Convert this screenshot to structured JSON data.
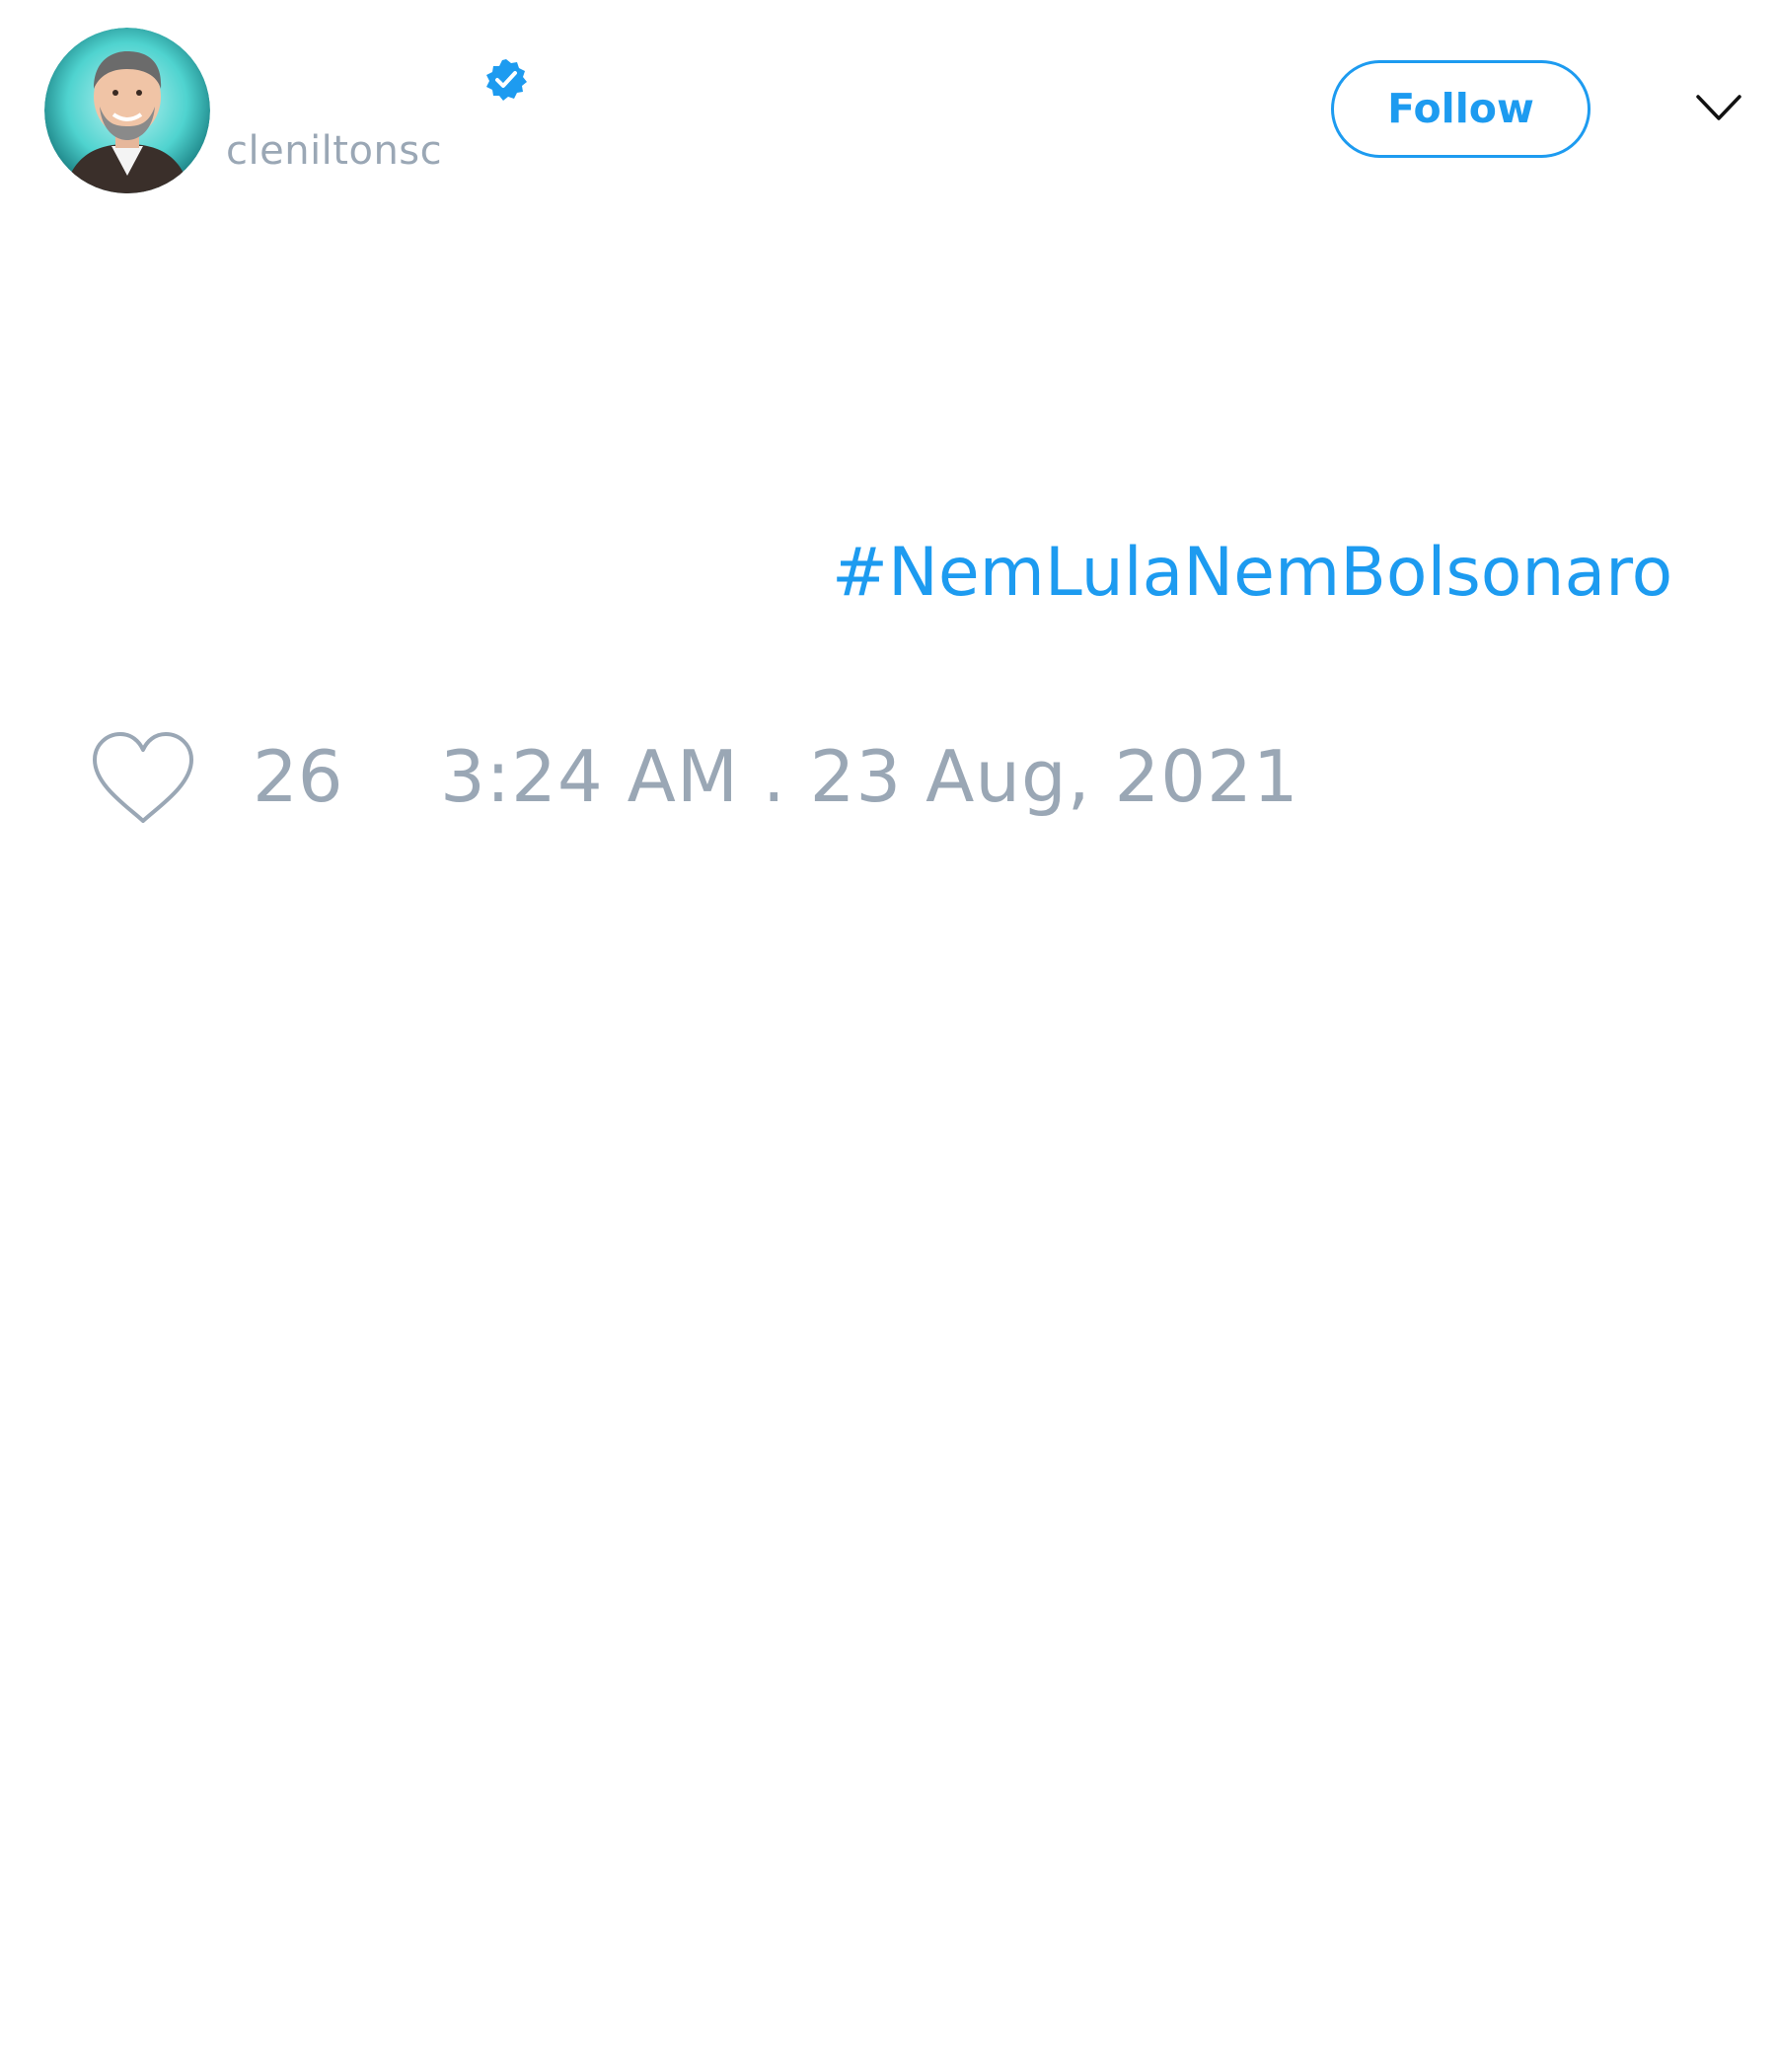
{
  "tweet": {
    "author": {
      "handle": "cleniltonsc",
      "verified": true,
      "avatar_icon": "profile-photo"
    },
    "follow_button_label": "Follow",
    "menu_icon": "chevron-down-icon",
    "hashtag": "#NemLulaNemBolsonaro",
    "like_icon": "heart-icon",
    "like_count": "26",
    "timestamp": "3:24 AM . 23 Aug, 2021"
  },
  "colors": {
    "accent": "#1d9bf0",
    "muted_text": "#9aa7b5",
    "background": "#ffffff"
  }
}
